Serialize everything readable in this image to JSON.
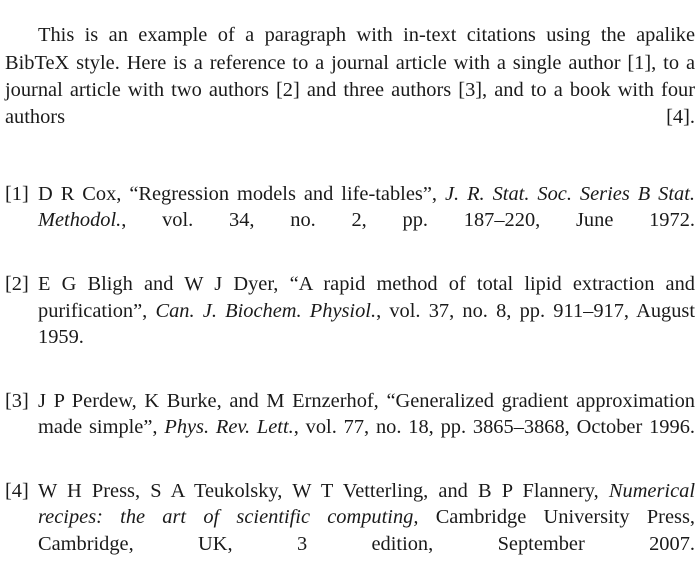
{
  "document": {
    "background_color": "#ffffff",
    "text_color": "#1a1a1a",
    "intro_paragraph": "This is an example of a paragraph with in-text citations using the apalike BibTeX style. Here is a reference to a journal article with a single author [1], to a journal article with two authors [2] and three authors [3], and to a book with four authors [4]."
  },
  "bibliography": {
    "entries": [
      {
        "label": "[1]",
        "authors": "D R Cox,",
        "title": "“Regression models and life-tables”,",
        "venue": "J. R. Stat. Soc. Series B Stat. Methodol.",
        "details": ", vol. 34, no. 2, pp. 187–220, June 1972."
      },
      {
        "label": "[2]",
        "authors": "E G Bligh and W J Dyer,",
        "title": "“A rapid method of total lipid extraction and purification”,",
        "venue": "Can. J. Biochem. Physiol.",
        "details": ", vol. 37, no. 8, pp. 911–917, August 1959."
      },
      {
        "label": "[3]",
        "authors": "J P Perdew, K Burke, and M Ernzerhof,",
        "title": "“Generalized gradient approximation made simple”,",
        "venue": "Phys. Rev. Lett.",
        "details": ", vol. 77, no. 18, pp. 3865–3868, October 1996."
      },
      {
        "label": "[4]",
        "authors": "W H Press, S A Teukolsky, W T Vetterling, and B P Flannery,",
        "title": "",
        "venue": "Numerical recipes: the art of scientific computing,",
        "details": " Cambridge University Press, Cambridge, UK, 3 edition, September 2007."
      }
    ]
  }
}
